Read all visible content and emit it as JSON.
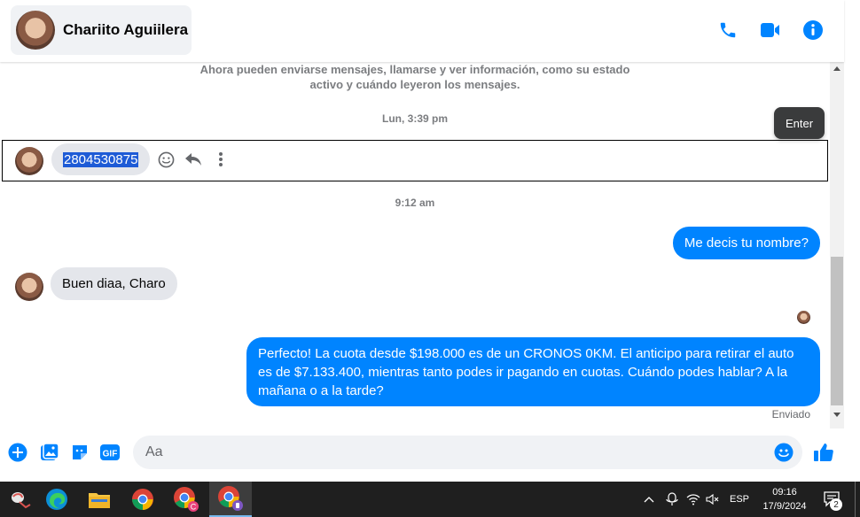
{
  "header": {
    "contact_name": "Chariito Aguiilera",
    "icons": [
      "phone-icon",
      "video-icon",
      "info-icon"
    ],
    "accent_color": "#0084ff"
  },
  "chat": {
    "system_note": "Ahora pueden enviarse mensajes, llamarse y ver información, como su estado activo y cuándo leyeron los mensajes.",
    "timestamp_1": "Lun, 3:39 pm",
    "selected_message": "2804530875",
    "tooltip": "Enter",
    "timestamp_2": "9:12 am",
    "outgoing_1": "Me decis tu nombre?",
    "incoming_1": "Buen diaa, Charo",
    "outgoing_2": "Perfecto! La cuota desde $198.000 es de un CRONOS 0KM. El anticipo para retirar el auto es de $7.133.400, mientras tanto podes ir pagando en cuotas. Cuándo podes hablar? A la mañana o a la tarde?",
    "status": "Enviado"
  },
  "composer": {
    "placeholder": "Aa",
    "icons": [
      "plus-icon",
      "image-icon",
      "sticker-icon",
      "gif-icon",
      "emoji-icon",
      "like-icon"
    ]
  },
  "taskbar": {
    "language": "ESP",
    "time": "09:16",
    "date": "17/9/2024",
    "notification_count": "2"
  }
}
